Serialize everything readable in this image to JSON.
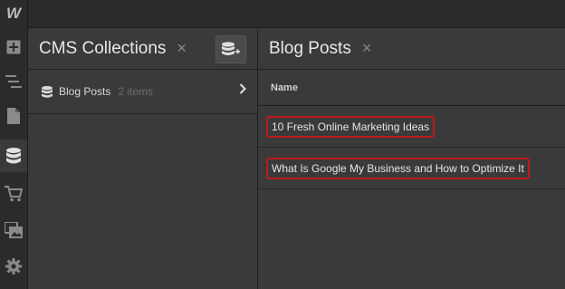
{
  "sidebar": {
    "logo": "W",
    "items": [
      {
        "icon": "add-icon"
      },
      {
        "icon": "navigator-icon"
      },
      {
        "icon": "pages-icon"
      },
      {
        "icon": "database-icon",
        "active": true
      },
      {
        "icon": "ecommerce-cart-icon"
      },
      {
        "icon": "assets-icon"
      },
      {
        "icon": "settings-gear-icon"
      }
    ]
  },
  "collections_panel": {
    "title": "CMS Collections",
    "close": "×",
    "items": [
      {
        "name": "Blog Posts",
        "count": "2 items"
      }
    ]
  },
  "posts_panel": {
    "title": "Blog Posts",
    "close": "×",
    "column_header": "Name",
    "rows": [
      {
        "name": "10 Fresh Online Marketing Ideas"
      },
      {
        "name": "What Is Google My Business and How to Optimize It"
      }
    ]
  },
  "colors": {
    "background": "#3a3a3a",
    "sidebar": "#2b2b2b",
    "highlight_border": "#c01a1a"
  }
}
